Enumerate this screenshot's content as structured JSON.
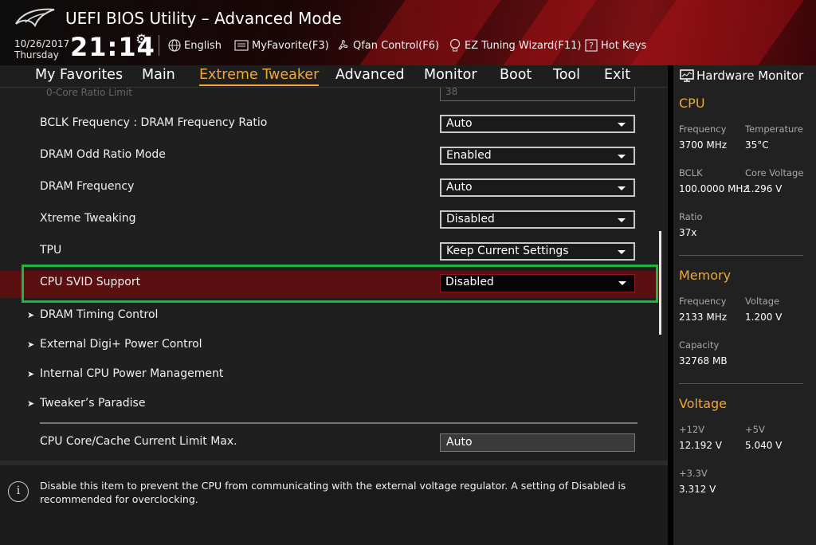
{
  "header": {
    "title": "UEFI BIOS Utility – Advanced Mode",
    "date": "10/26/2017",
    "day": "Thursday",
    "time": "21:14",
    "language": "English",
    "myfavorite": "MyFavorite(F3)",
    "qfan": "Qfan Control(F6)",
    "ez_tuning": "EZ Tuning Wizard(F11)",
    "hotkeys": "Hot Keys"
  },
  "menu": {
    "items": [
      "My Favorites",
      "Main",
      "Extreme Tweaker",
      "Advanced",
      "Monitor",
      "Boot",
      "Tool",
      "Exit"
    ],
    "active": "Extreme Tweaker"
  },
  "settings": {
    "ghost_label": "0-Core Ratio Limit",
    "ghost_value": "38",
    "rows": [
      {
        "label": "BCLK Frequency : DRAM Frequency Ratio",
        "value": "Auto"
      },
      {
        "label": "DRAM Odd Ratio Mode",
        "value": "Enabled"
      },
      {
        "label": "DRAM Frequency",
        "value": "Auto"
      },
      {
        "label": "Xtreme Tweaking",
        "value": "Disabled"
      },
      {
        "label": "TPU",
        "value": "Keep Current Settings"
      },
      {
        "label": "CPU SVID Support",
        "value": "Disabled"
      }
    ],
    "submenus": [
      "DRAM Timing Control",
      "External Digi+ Power Control",
      "Internal CPU Power Management",
      "Tweaker’s Paradise"
    ],
    "current_limit_label": "CPU Core/Cache Current Limit Max.",
    "current_limit_value": "Auto"
  },
  "help": {
    "text": "Disable this item to prevent the CPU from communicating with the external voltage regulator. A setting of Disabled is recommended for overclocking."
  },
  "hwmon": {
    "title": "Hardware Monitor",
    "cpu": {
      "title": "CPU",
      "freq_label": "Frequency",
      "freq": "3700 MHz",
      "temp_label": "Temperature",
      "temp": "35°C",
      "bclk_label": "BCLK",
      "bclk": "100.0000 MHz",
      "corev_label": "Core Voltage",
      "corev": "1.296 V",
      "ratio_label": "Ratio",
      "ratio": "37x"
    },
    "memory": {
      "title": "Memory",
      "freq_label": "Frequency",
      "freq": "2133 MHz",
      "volt_label": "Voltage",
      "volt": "1.200 V",
      "cap_label": "Capacity",
      "cap": "32768 MB"
    },
    "voltage": {
      "title": "Voltage",
      "v12_label": "+12V",
      "v12": "12.192 V",
      "v5_label": "+5V",
      "v5": "5.040 V",
      "v33_label": "+3.3V",
      "v33": "3.312 V"
    }
  },
  "colors": {
    "accent": "#f0a830",
    "selection": "#5a0f11",
    "highlight_frame": "#1fb540"
  }
}
